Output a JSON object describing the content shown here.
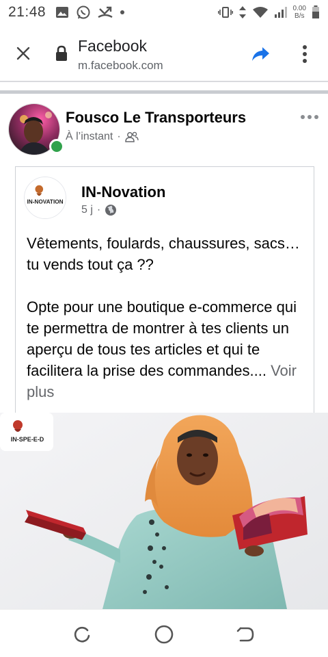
{
  "status_bar": {
    "time": "21:48",
    "net_speed_value": "0.00",
    "net_speed_unit": "B/s",
    "icons": [
      "gallery-icon",
      "whatsapp-icon",
      "missed-call-icon",
      "dot-icon",
      "vibrate-icon",
      "data-arrows-icon",
      "wifi-icon",
      "signal-icon",
      "battery-icon"
    ]
  },
  "browser": {
    "title": "Facebook",
    "url": "m.facebook.com",
    "accent": "#1a73e8"
  },
  "post": {
    "author": "Fousco Le Transporteurs",
    "timestamp": "À l’instant",
    "dot": "·",
    "audience_icon": "friends-icon",
    "online_color": "#31a24c",
    "shared": {
      "page_name": "IN-Novation",
      "timestamp": "5 j",
      "dot": "·",
      "audience_icon": "globe-icon",
      "paragraph_1": "Vêtements, foulards, chaussures, sacs… tu vends tout ça ??",
      "paragraph_2": "Opte pour une boutique e-commerce qui te permettra de montrer à tes clients un aperçu de tous tes articles et qui te facilitera la prise des commandes....",
      "see_more": "Voir plus"
    },
    "image": {
      "logo_text": "IN-SPE-E-D",
      "page_logo_text": "IN-NOVATION"
    }
  },
  "navbar": {
    "icons": [
      "recents-icon",
      "home-icon",
      "back-icon"
    ]
  }
}
